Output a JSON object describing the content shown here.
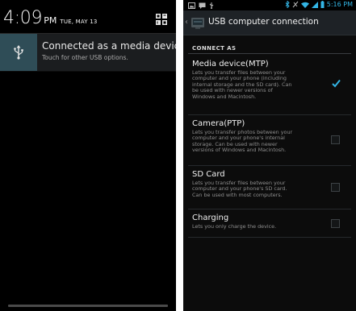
{
  "left": {
    "time": "4:09",
    "ampm": "PM",
    "date": "TUE, MAY 13",
    "notification": {
      "title": "Connected as a media device",
      "subtitle": "Touch for other USB options."
    }
  },
  "right": {
    "status_time": "5:16 PM",
    "title": "USB computer connection",
    "section": "CONNECT AS",
    "options": [
      {
        "title": "Media device(MTP)",
        "lines": [
          "Lets you transfer files between your",
          "computer and your phone (including",
          "internal storage and the SD card). Can",
          "be used with newer versions of",
          "Windows and Macintosh."
        ],
        "checked": true
      },
      {
        "title": "Camera(PTP)",
        "lines": [
          "Lets you transfer photos between your",
          "computer and your phone's internal",
          "storage. Can be used with newer",
          "versions of Windows and Macintosh."
        ],
        "checked": false
      },
      {
        "title": "SD Card",
        "lines": [
          "Lets you transfer files between your",
          "computer and your phone's SD card.",
          "Can be used with most computers."
        ],
        "checked": false
      },
      {
        "title": "Charging",
        "lines": [
          "Lets you only charge the device."
        ],
        "checked": false
      }
    ],
    "accent_color": "#33b5e5"
  }
}
